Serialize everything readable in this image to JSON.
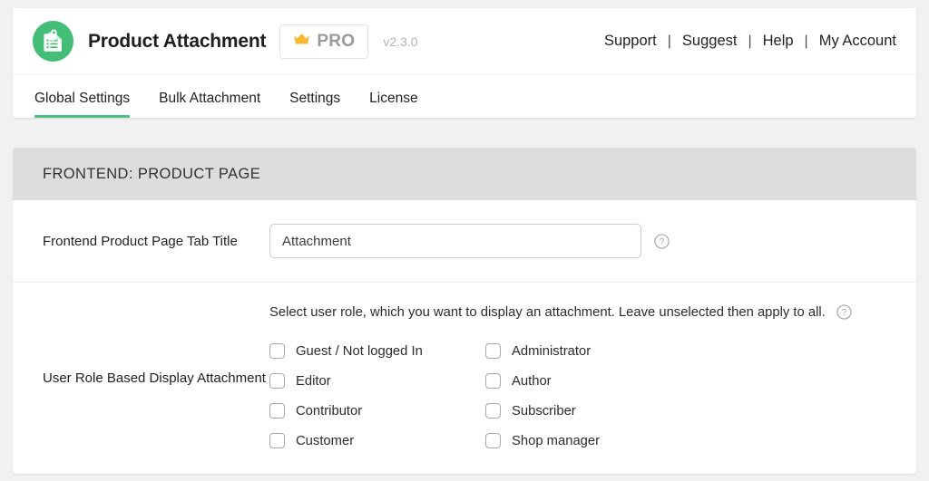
{
  "header": {
    "logo_icon": "document-attachment-icon",
    "brand_title": "Product Attachment",
    "pro_badge": {
      "icon": "crown-icon",
      "label": "PRO"
    },
    "version": "v2.3.0",
    "separator": "|",
    "links": [
      {
        "name": "support",
        "label": "Support"
      },
      {
        "name": "suggest",
        "label": "Suggest"
      },
      {
        "name": "help",
        "label": "Help"
      },
      {
        "name": "my-account",
        "label": "My Account"
      }
    ]
  },
  "tabs": [
    {
      "name": "global-settings",
      "label": "Global Settings",
      "active": true
    },
    {
      "name": "bulk-attachment",
      "label": "Bulk Attachment",
      "active": false
    },
    {
      "name": "settings",
      "label": "Settings",
      "active": false
    },
    {
      "name": "license",
      "label": "License",
      "active": false
    }
  ],
  "panel": {
    "section_title": "FRONTEND: PRODUCT PAGE",
    "tab_title_field": {
      "label": "Frontend Product Page Tab Title",
      "value": "Attachment",
      "placeholder": "Attachment",
      "help_icon": "question-mark-circle-icon"
    },
    "user_roles_field": {
      "label": "User Role Based Display Attachment",
      "description": "Select user role, which you want to display an attachment. Leave unselected then apply to all.",
      "help_icon": "question-mark-circle-icon",
      "roles": [
        {
          "name": "guest-not-logged-in",
          "label": "Guest / Not logged In",
          "checked": false
        },
        {
          "name": "administrator",
          "label": "Administrator",
          "checked": false
        },
        {
          "name": "editor",
          "label": "Editor",
          "checked": false
        },
        {
          "name": "author",
          "label": "Author",
          "checked": false
        },
        {
          "name": "contributor",
          "label": "Contributor",
          "checked": false
        },
        {
          "name": "subscriber",
          "label": "Subscriber",
          "checked": false
        },
        {
          "name": "customer",
          "label": "Customer",
          "checked": false
        },
        {
          "name": "shop-manager",
          "label": "Shop manager",
          "checked": false
        }
      ]
    }
  },
  "colors": {
    "brand_green": "#44bd76",
    "tab_underline": "#4cbe7d",
    "pro_gold": "#f7b733",
    "page_bg": "#f1f1f1",
    "section_header_bg": "#dddddd"
  }
}
